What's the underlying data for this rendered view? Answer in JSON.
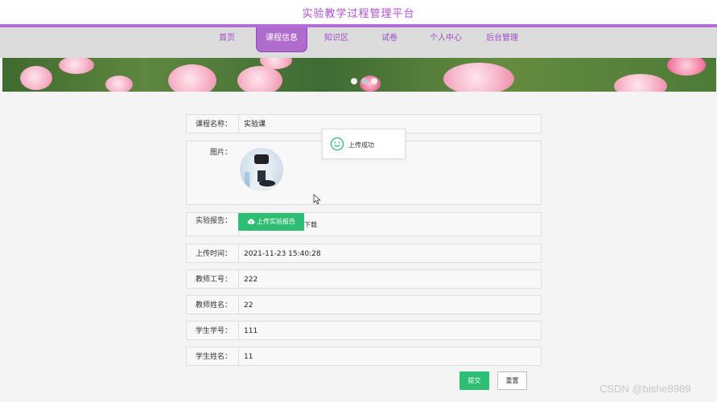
{
  "app": {
    "title": "实验教学过程管理平台"
  },
  "nav": {
    "items": [
      "首页",
      "课程信息",
      "知识区",
      "试卷",
      "个人中心",
      "后台管理"
    ],
    "active": "课程信息"
  },
  "form": {
    "course_name": {
      "label": "课程名称：",
      "value": "实验课"
    },
    "image": {
      "label": "图片："
    },
    "report": {
      "label": "实验报告：",
      "upload_button": "上传实验报告",
      "download_text": "下载"
    },
    "upload_time": {
      "label": "上传时间：",
      "value": "2021-11-23 15:40:28"
    },
    "teacher_id": {
      "label": "教师工号：",
      "value": "222"
    },
    "teacher_name": {
      "label": "教师姓名：",
      "value": "22"
    },
    "student_id": {
      "label": "学生学号：",
      "value": "111"
    },
    "student_name": {
      "label": "学生姓名：",
      "value": "11"
    }
  },
  "toast": {
    "message": "上传成功",
    "icon": "smile-icon"
  },
  "actions": {
    "submit": "提交",
    "reset": "重置"
  },
  "watermark": "CSDN @bishe8989",
  "colors": {
    "brand": "#b24fcf",
    "nav_active": "#b06ccd",
    "primary_button": "#2dbd73"
  }
}
